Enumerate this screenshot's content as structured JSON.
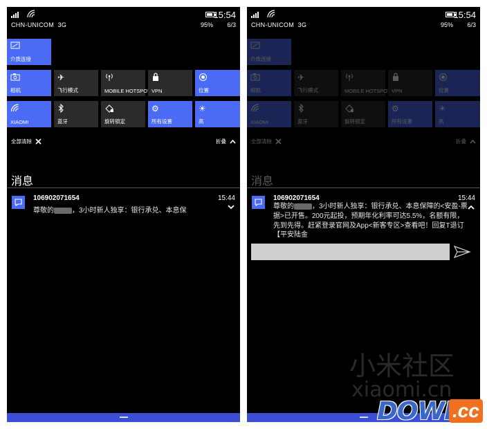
{
  "status": {
    "time": "15:54",
    "carrier": "CHN-UNICOM",
    "network": "3G",
    "battery": "95%",
    "date": "6/3"
  },
  "tiles": {
    "connect": "介质连接",
    "camera": "相机",
    "airplane": "飞行模式",
    "hotspot": "MOBILE HOTSPOT",
    "vpn": "VPN",
    "location": "位置",
    "wifi": "XIAOMI",
    "bluetooth": "蓝牙",
    "rotation": "旋转锁定",
    "settings": "所有设置",
    "brightness": "高"
  },
  "actions": {
    "clear_all": "全部清除",
    "collapse": "折叠"
  },
  "messages_header": "消息",
  "notification": {
    "sender": "106902071654",
    "time": "15:44",
    "preview_pre": "尊敬的",
    "preview_post": "，3小时新人独享：银行承兑、本息保",
    "full_pre": "尊敬的",
    "full_post": "，3小时新人独享：银行承兑、本息保障的<安盈-票据>已开售。200元起投，预期年化利率可达5.5%，名额有限，先到先得。赶紧登录官网及App<新客专区>查看吧！回复T退订【平安陆金"
  },
  "reply": {
    "placeholder": ""
  },
  "watermarks": {
    "xiaomi_cn": "小米社区",
    "xiaomi_en": "xiaomi.cn",
    "down": "DOWN",
    "cc": ".cc"
  },
  "colors": {
    "accent": "#4b6bf5",
    "tile_off": "#2b2b2b",
    "nav": "#3b4fd6"
  }
}
